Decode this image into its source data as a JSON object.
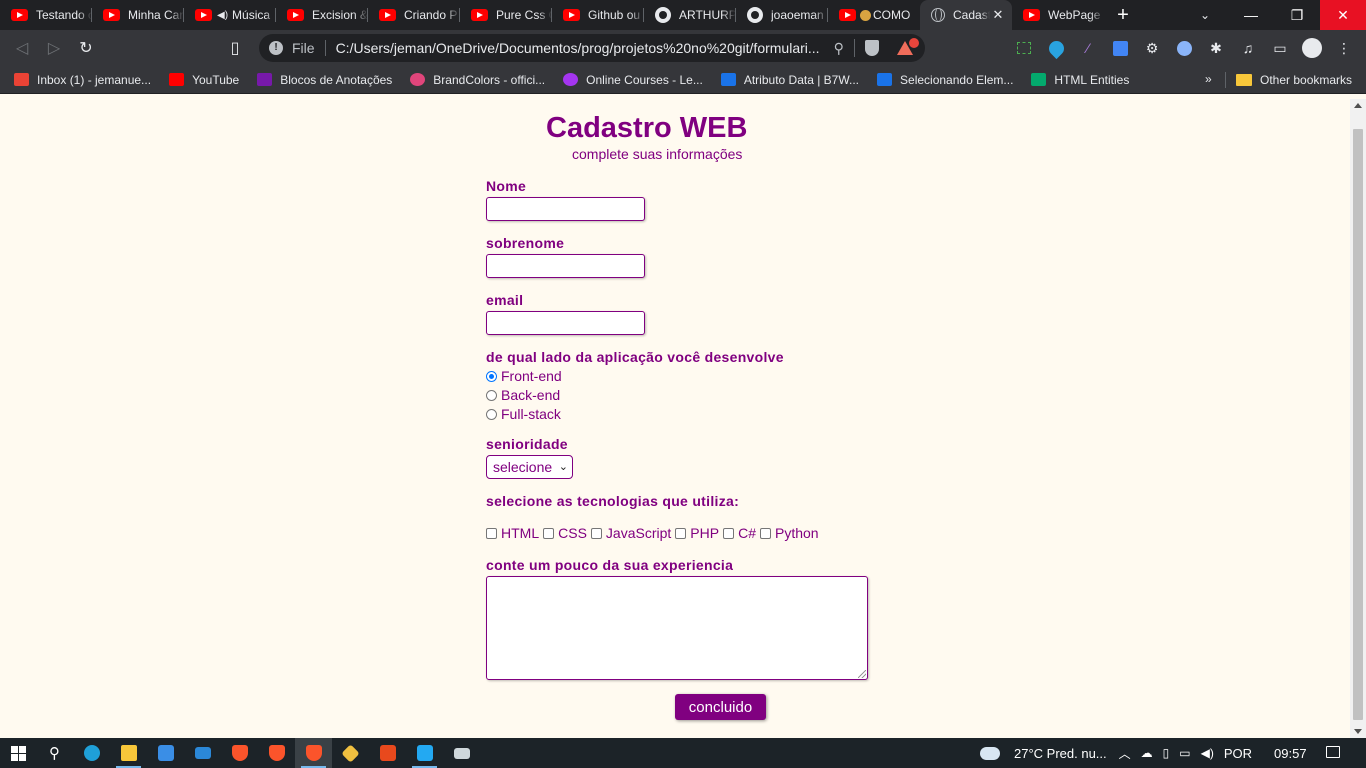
{
  "browser": {
    "tabs": [
      {
        "title": "Testando c",
        "icon": "youtube-icon"
      },
      {
        "title": "Minha Car",
        "icon": "youtube-icon"
      },
      {
        "title": "Música",
        "icon": "youtube-icon",
        "audio": "speaker-icon"
      },
      {
        "title": "Excision &",
        "icon": "youtube-icon"
      },
      {
        "title": "Criando P",
        "icon": "youtube-icon"
      },
      {
        "title": "Pure Css C",
        "icon": "youtube-icon"
      },
      {
        "title": "Github ou",
        "icon": "youtube-icon"
      },
      {
        "title": "ARTHURP",
        "icon": "github-icon"
      },
      {
        "title": "joaoeman",
        "icon": "github-icon"
      },
      {
        "title": "COMO",
        "icon": "youtube-icon"
      },
      {
        "title": "Cadast",
        "icon": "globe-icon",
        "active": true,
        "close": "✕"
      },
      {
        "title": "WebPage",
        "icon": "youtube-icon"
      }
    ],
    "new_tab": "+",
    "tab_search": "⌄",
    "window_controls": {
      "minimize": "—",
      "maximize": "❐",
      "close": "✕"
    },
    "omnibox": {
      "info": "!",
      "label": "File",
      "url": "C:/Users/jeman/OneDrive/Documentos/prog/projetos%20no%20git/formulari..."
    },
    "bookmarks": [
      {
        "label": "Inbox (1) - jemanue...",
        "icon": "gmail-icon",
        "color": "#ea4335"
      },
      {
        "label": "YouTube",
        "icon": "youtube-icon",
        "color": "#ff0000"
      },
      {
        "label": "Blocos de Anotações",
        "icon": "onenote-icon",
        "color": "#7719aa"
      },
      {
        "label": "BrandColors - offici...",
        "icon": "brandcolors-icon",
        "color": "#e0457b"
      },
      {
        "label": "Online Courses - Le...",
        "icon": "udemy-icon",
        "color": "#a435f0"
      },
      {
        "label": "Atributo Data | B7W...",
        "icon": "b7web-icon",
        "color": "#1a73e8"
      },
      {
        "label": "Selecionando Elem...",
        "icon": "b7web-icon",
        "color": "#1a73e8"
      },
      {
        "label": "HTML Entities",
        "icon": "w3-icon",
        "color": "#04aa6d"
      }
    ],
    "bookmarks_more": "»",
    "other_bookmarks": "Other bookmarks"
  },
  "form": {
    "title": "Cadastro WEB",
    "subtitle": "complete suas informações",
    "fields": {
      "nome": "Nome",
      "sobrenome": "sobrenome",
      "email": "email"
    },
    "side_question": "de qual lado da aplicação você desenvolve",
    "sides": [
      {
        "label": "Front-end",
        "checked": true
      },
      {
        "label": "Back-end",
        "checked": false
      },
      {
        "label": "Full-stack",
        "checked": false
      }
    ],
    "seniority_label": "senioridade",
    "seniority_selected": "selecione",
    "tech_question": "selecione as tecnologias que utiliza:",
    "techs": [
      "HTML",
      "CSS",
      "JavaScript",
      "PHP",
      "C#",
      "Python"
    ],
    "experience_label": "conte um pouco da sua experiencia",
    "submit": "concluido"
  },
  "taskbar": {
    "weather": "27°C  Pred. nu...",
    "language": "POR",
    "time": "09:57"
  },
  "colors": {
    "accent": "#800080",
    "page_bg": "#fffaf0"
  }
}
